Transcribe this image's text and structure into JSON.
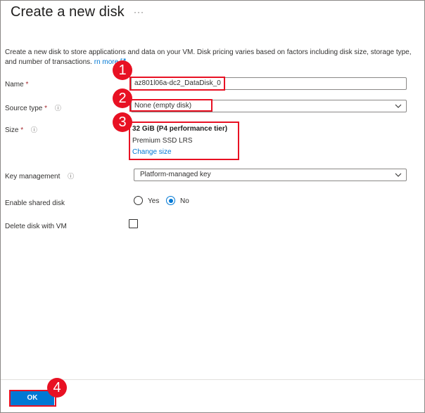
{
  "panel": {
    "title": "Create a new disk",
    "more_label": "···"
  },
  "description": {
    "text": "Create a new disk to store applications and data on your VM. Disk pricing varies based on factors including disk size, storage type, and number of transactions.",
    "link_label": "Learn more",
    "visible_link_label": "rn more",
    "link_icon": "external-link-icon"
  },
  "form": {
    "name": {
      "label": "Name",
      "required": "*",
      "value": "az801l06a-dc2_DataDisk_0"
    },
    "source_type": {
      "label": "Source type",
      "required": "*",
      "info": "ⓘ",
      "value": "None (empty disk)",
      "chevron": "chevron-down-icon"
    },
    "size": {
      "label": "Size",
      "required": "*",
      "info": "ⓘ",
      "value": "32 GiB (P4 performance tier)",
      "sku": "Premium SSD LRS",
      "change_link": "Change size"
    },
    "key_management": {
      "label": "Key management",
      "info": "ⓘ",
      "value": "Platform-managed key",
      "chevron": "chevron-down-icon"
    },
    "shared_disk": {
      "label": "Enable shared disk",
      "options": [
        "Yes",
        "No"
      ],
      "selected": "No"
    },
    "delete_with_vm": {
      "label": "Delete disk with VM",
      "checked": false
    }
  },
  "footer": {
    "ok_label": "OK"
  },
  "callouts": {
    "color": "#e81123",
    "numbers": [
      "1",
      "2",
      "3",
      "4"
    ]
  },
  "colors": {
    "accent": "#0078d4",
    "required": "#a4262c",
    "callout": "#e81123"
  }
}
